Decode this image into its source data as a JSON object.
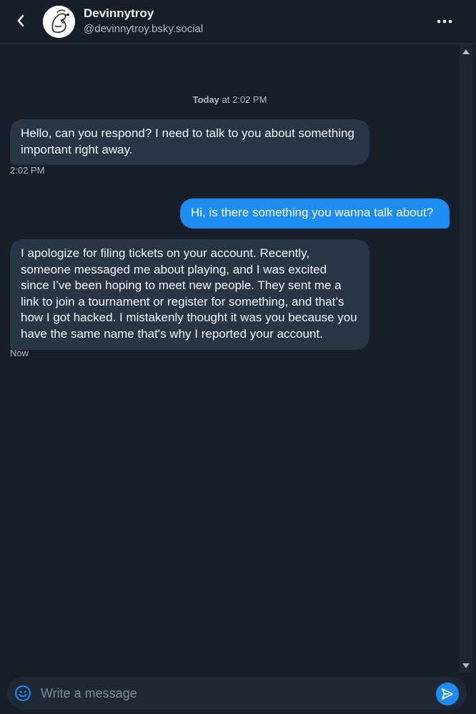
{
  "header": {
    "display_name": "Devinnytroy",
    "handle": "@devinnytroy.bsky.social"
  },
  "conversation": {
    "date_label": "Today",
    "date_suffix": " at 2:02 PM",
    "messages": [
      {
        "direction": "incoming",
        "text": "Hello, can you respond? I need to talk to you about something important right away.",
        "time": "2:02 PM"
      },
      {
        "direction": "outgoing",
        "text": "Hi, is there something you wanna talk about?"
      },
      {
        "direction": "incoming",
        "text": "I apologize for filing tickets on your account. Recently, someone messaged me about playing, and I was excited since I’ve been hoping to meet new people. They sent me a link to join a tournament or register for something, and that’s how I got hacked. I mistakenly thought it was you because you have the same name that's why I reported your account.",
        "time": "Now"
      }
    ]
  },
  "composer": {
    "placeholder": "Write a message"
  },
  "icons": {
    "back": "chevron-left-icon",
    "more": "more-horizontal-icon",
    "emoji": "smiley-icon",
    "send": "paper-plane-icon"
  },
  "colors": {
    "background": "#161e27",
    "incoming_bubble": "#283545",
    "outgoing_bubble": "#1d8cf3",
    "accent": "#1d8cf3"
  }
}
